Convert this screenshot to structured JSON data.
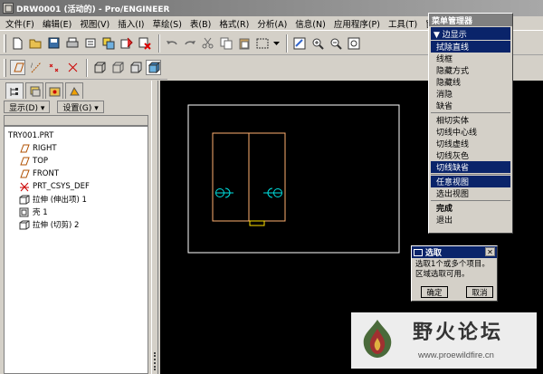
{
  "window": {
    "title": "DRW0001 (活动的) - Pro/ENGINEER"
  },
  "menubar": {
    "items": [
      "文件(F)",
      "编辑(E)",
      "视图(V)",
      "插入(I)",
      "草绘(S)",
      "表(B)",
      "格式(R)",
      "分析(A)",
      "信息(N)",
      "应用程序(P)",
      "工具(T)",
      "窗"
    ]
  },
  "toolbar": {
    "icons": [
      "new-icon",
      "open-icon",
      "save-icon",
      "print-icon",
      "send-icon",
      "regen-icon",
      "layer-icon",
      "delete-icon",
      "undo-icon",
      "redo-icon",
      "cut-icon",
      "copy-icon",
      "paste-icon",
      "select-box-icon",
      "repaint-icon",
      "zoom-in-icon",
      "zoom-out-icon",
      "zoom-fit-icon"
    ]
  },
  "panel": {
    "show_label": "显示(D) ▾",
    "settings_label": "设置(G) ▾",
    "tree": [
      {
        "label": "TRY001.PRT",
        "icon": "part-icon",
        "level": 0
      },
      {
        "label": "RIGHT",
        "icon": "datum-plane-icon",
        "level": 1
      },
      {
        "label": "TOP",
        "icon": "datum-plane-icon",
        "level": 1
      },
      {
        "label": "FRONT",
        "icon": "datum-plane-icon",
        "level": 1
      },
      {
        "label": "PRT_CSYS_DEF",
        "icon": "csys-icon",
        "level": 1
      },
      {
        "label": "拉伸 (伸出项) 1",
        "icon": "extrude-icon",
        "level": 1
      },
      {
        "label": "壳 1",
        "icon": "shell-icon",
        "level": 1
      },
      {
        "label": "拉伸 (切剪) 2",
        "icon": "extrude-icon",
        "level": 1
      }
    ]
  },
  "menu_manager": {
    "title": "菜单管理器",
    "header": "▼ 边显示",
    "groups": [
      [
        {
          "label": "拭除直线",
          "selected": true
        },
        {
          "label": "线框",
          "selected": false
        },
        {
          "label": "隐藏方式",
          "selected": false
        },
        {
          "label": "隐藏线",
          "selected": false
        },
        {
          "label": "消隐",
          "selected": false
        },
        {
          "label": "缺省",
          "selected": false
        }
      ],
      [
        {
          "label": "相切实体",
          "selected": false
        },
        {
          "label": "切线中心线",
          "selected": false
        },
        {
          "label": "切线虚线",
          "selected": false
        },
        {
          "label": "切线灰色",
          "selected": false
        },
        {
          "label": "切线缺省",
          "selected": true
        }
      ],
      [
        {
          "label": "任意视图",
          "selected": true
        },
        {
          "label": "选出视图",
          "selected": false
        }
      ],
      [
        {
          "label": "完成",
          "selected": false,
          "bold": true
        },
        {
          "label": "退出",
          "selected": false
        }
      ]
    ]
  },
  "select_dialog": {
    "title": "选取",
    "line1": "选取1个或多个项目。",
    "line2": "区域选取可用。",
    "ok": "确定",
    "cancel": "取消"
  },
  "watermark": {
    "title": "野火论坛",
    "url": "www.proewildfire.cn"
  },
  "colors": {
    "selection": "#0a246a",
    "drawing_line": "#ffb070",
    "sheet_border": "#ffffff",
    "hole_color": "#00e0e0"
  }
}
